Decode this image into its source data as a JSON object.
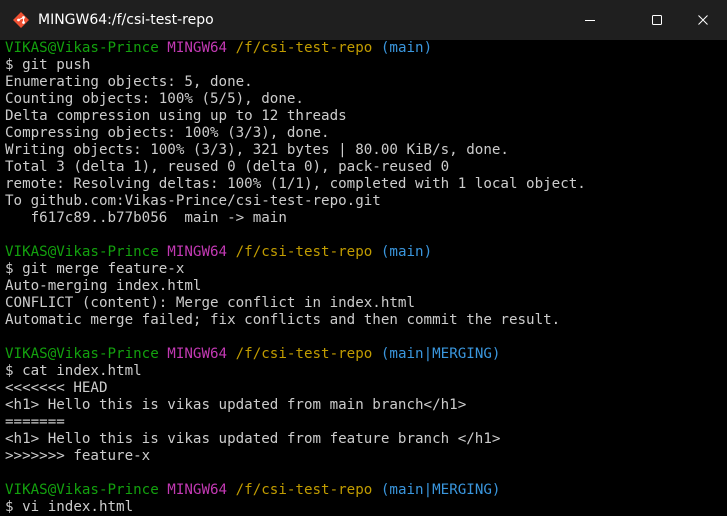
{
  "window": {
    "title": "MINGW64:/f/csi-test-repo"
  },
  "colors": {
    "user_host": "#13a10e",
    "mingw": "#c239b3",
    "path": "#c19c00",
    "branch": "#3a96dd",
    "text": "#cccccc",
    "titlebar_bg": "#1f1f1f",
    "terminal_bg": "#000000"
  },
  "icons": {
    "app": "git-bash-icon",
    "minimize": "minimize-icon",
    "maximize": "maximize-icon",
    "close": "close-icon"
  },
  "terminal": {
    "lines": [
      {
        "kind": "prompt",
        "user": "VIKAS@Vikas-Prince",
        "env": "MINGW64",
        "path": "/f/csi-test-repo",
        "branch": "(main)"
      },
      {
        "kind": "text",
        "text": "$ git push"
      },
      {
        "kind": "text",
        "text": "Enumerating objects: 5, done."
      },
      {
        "kind": "text",
        "text": "Counting objects: 100% (5/5), done."
      },
      {
        "kind": "text",
        "text": "Delta compression using up to 12 threads"
      },
      {
        "kind": "text",
        "text": "Compressing objects: 100% (3/3), done."
      },
      {
        "kind": "text",
        "text": "Writing objects: 100% (3/3), 321 bytes | 80.00 KiB/s, done."
      },
      {
        "kind": "text",
        "text": "Total 3 (delta 1), reused 0 (delta 0), pack-reused 0"
      },
      {
        "kind": "text",
        "text": "remote: Resolving deltas: 100% (1/1), completed with 1 local object."
      },
      {
        "kind": "text",
        "text": "To github.com:Vikas-Prince/csi-test-repo.git"
      },
      {
        "kind": "text",
        "text": "   f617c89..b77b056  main -> main"
      },
      {
        "kind": "text",
        "text": ""
      },
      {
        "kind": "prompt",
        "user": "VIKAS@Vikas-Prince",
        "env": "MINGW64",
        "path": "/f/csi-test-repo",
        "branch": "(main)"
      },
      {
        "kind": "text",
        "text": "$ git merge feature-x"
      },
      {
        "kind": "text",
        "text": "Auto-merging index.html"
      },
      {
        "kind": "text",
        "text": "CONFLICT (content): Merge conflict in index.html"
      },
      {
        "kind": "text",
        "text": "Automatic merge failed; fix conflicts and then commit the result."
      },
      {
        "kind": "text",
        "text": ""
      },
      {
        "kind": "prompt",
        "user": "VIKAS@Vikas-Prince",
        "env": "MINGW64",
        "path": "/f/csi-test-repo",
        "branch": "(main|MERGING)"
      },
      {
        "kind": "text",
        "text": "$ cat index.html"
      },
      {
        "kind": "text",
        "text": "<<<<<<< HEAD"
      },
      {
        "kind": "text",
        "text": "<h1> Hello this is vikas updated from main branch</h1>"
      },
      {
        "kind": "text",
        "text": "======="
      },
      {
        "kind": "text",
        "text": "<h1> Hello this is vikas updated from feature branch </h1>"
      },
      {
        "kind": "text",
        "text": ">>>>>>> feature-x"
      },
      {
        "kind": "text",
        "text": ""
      },
      {
        "kind": "prompt",
        "user": "VIKAS@Vikas-Prince",
        "env": "MINGW64",
        "path": "/f/csi-test-repo",
        "branch": "(main|MERGING)"
      },
      {
        "kind": "text",
        "text": "$ vi index.html"
      }
    ]
  }
}
